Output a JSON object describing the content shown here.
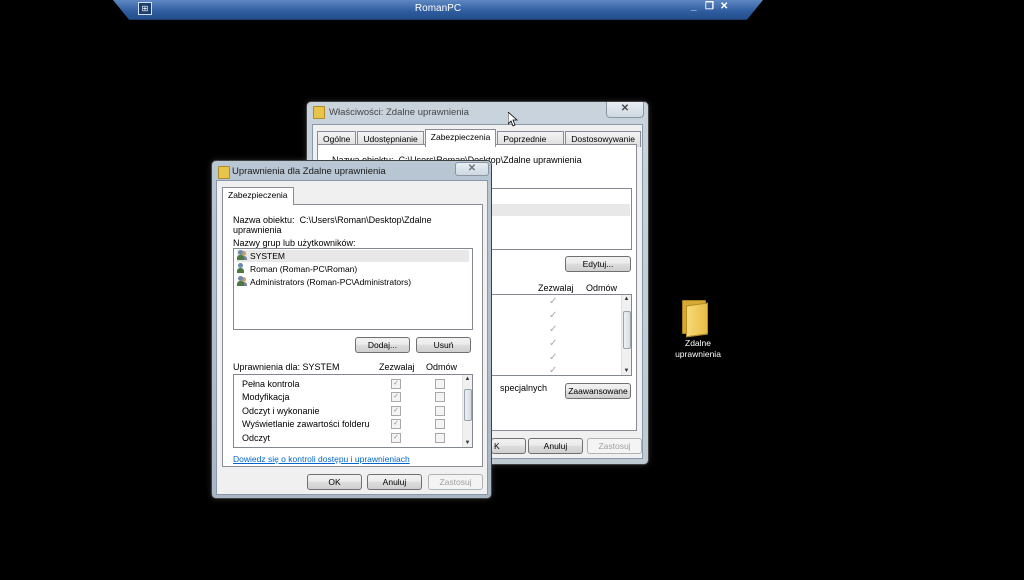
{
  "remote_bar": {
    "title": "RomanPC",
    "minimize": "_",
    "restore": "❐",
    "close": "✕"
  },
  "desktop": {
    "folder_label_line1": "Zdalne",
    "folder_label_line2": "uprawnienia"
  },
  "props_window": {
    "title": "Właściwości: Zdalne uprawnienia",
    "close": "✕",
    "tabs": [
      "Ogólne",
      "Udostępnianie",
      "Zabezpieczenia",
      "Poprzednie wersje",
      "Dostosowywanie"
    ],
    "active_tab": "Zabezpieczenia",
    "object_name_label": "Nazwa obiektu:",
    "object_name_value": "C:\\Users\\Roman\\Desktop\\Zdalne uprawnienia",
    "edit_button": "Edytuj...",
    "col_allow": "Zezwalaj",
    "col_deny": "Odmów",
    "special_text": "specjalnych",
    "advanced_button": "Zaawansowane",
    "ok_button_partial": "K",
    "cancel_button": "Anuluj",
    "apply_button": "Zastosuj"
  },
  "perm_window": {
    "title": "Uprawnienia dla Zdalne uprawnienia",
    "close": "✕",
    "tab": "Zabezpieczenia",
    "object_name_label": "Nazwa obiektu:",
    "object_name_value": "C:\\Users\\Roman\\Desktop\\Zdalne uprawnienia",
    "groups_label": "Nazwy grup lub użytkowników:",
    "users": [
      "SYSTEM",
      "Roman (Roman-PC\\Roman)",
      "Administrators (Roman-PC\\Administrators)"
    ],
    "add_button": "Dodaj...",
    "remove_button": "Usuń",
    "permissions_for": "Uprawnienia dla: SYSTEM",
    "col_allow": "Zezwalaj",
    "col_deny": "Odmów",
    "permissions": [
      {
        "name": "Pełna kontrola",
        "allow": true,
        "deny": false
      },
      {
        "name": "Modyfikacja",
        "allow": true,
        "deny": false
      },
      {
        "name": "Odczyt i wykonanie",
        "allow": true,
        "deny": false
      },
      {
        "name": "Wyświetlanie zawartości folderu",
        "allow": true,
        "deny": false
      },
      {
        "name": "Odczyt",
        "allow": true,
        "deny": false
      }
    ],
    "learn_link": "Dowiedz się o kontroli dostępu i uprawnieniach",
    "ok_button": "OK",
    "cancel_button": "Anuluj",
    "apply_button": "Zastosuj"
  }
}
